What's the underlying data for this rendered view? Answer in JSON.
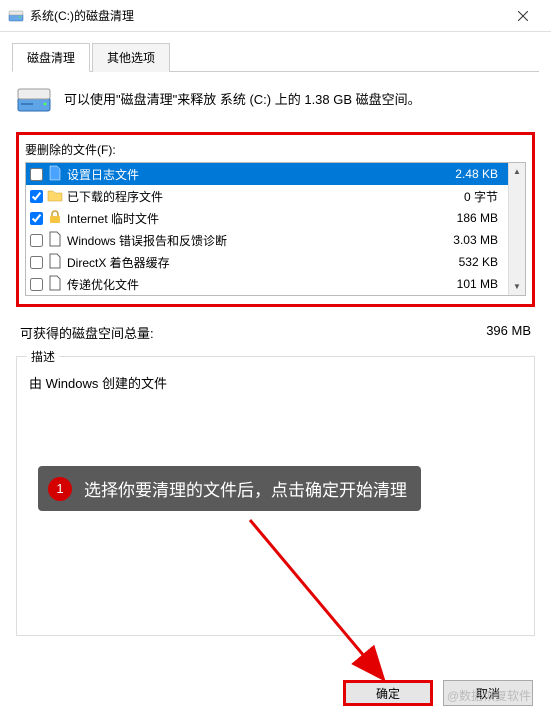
{
  "window": {
    "title": "系统(C:)的磁盘清理"
  },
  "tabs": [
    {
      "label": "磁盘清理",
      "active": true
    },
    {
      "label": "其他选项",
      "active": false
    }
  ],
  "info_text": "可以使用\"磁盘清理\"来释放 系统 (C:) 上的 1.38 GB 磁盘空间。",
  "files_label": "要删除的文件(F):",
  "files": [
    {
      "checked": false,
      "icon": "file-blue",
      "name": "设置日志文件",
      "size": "2.48 KB",
      "selected": true
    },
    {
      "checked": true,
      "icon": "folder",
      "name": "已下载的程序文件",
      "size": "0 字节",
      "selected": false
    },
    {
      "checked": true,
      "icon": "lock",
      "name": "Internet 临时文件",
      "size": "186 MB",
      "selected": false
    },
    {
      "checked": false,
      "icon": "file",
      "name": "Windows 错误报告和反馈诊断",
      "size": "3.03 MB",
      "selected": false
    },
    {
      "checked": false,
      "icon": "file",
      "name": "DirectX 着色器缓存",
      "size": "532 KB",
      "selected": false
    },
    {
      "checked": false,
      "icon": "file",
      "name": "传递优化文件",
      "size": "101 MB",
      "selected": false
    }
  ],
  "space": {
    "label": "可获得的磁盘空间总量:",
    "value": "396 MB"
  },
  "description": {
    "legend": "描述",
    "text": "由 Windows 创建的文件"
  },
  "annotation": {
    "num": "1",
    "text": "选择你要清理的文件后，点击确定开始清理"
  },
  "buttons": {
    "ok": "确定",
    "cancel": "取消"
  },
  "watermark": "@数据恢复软件"
}
